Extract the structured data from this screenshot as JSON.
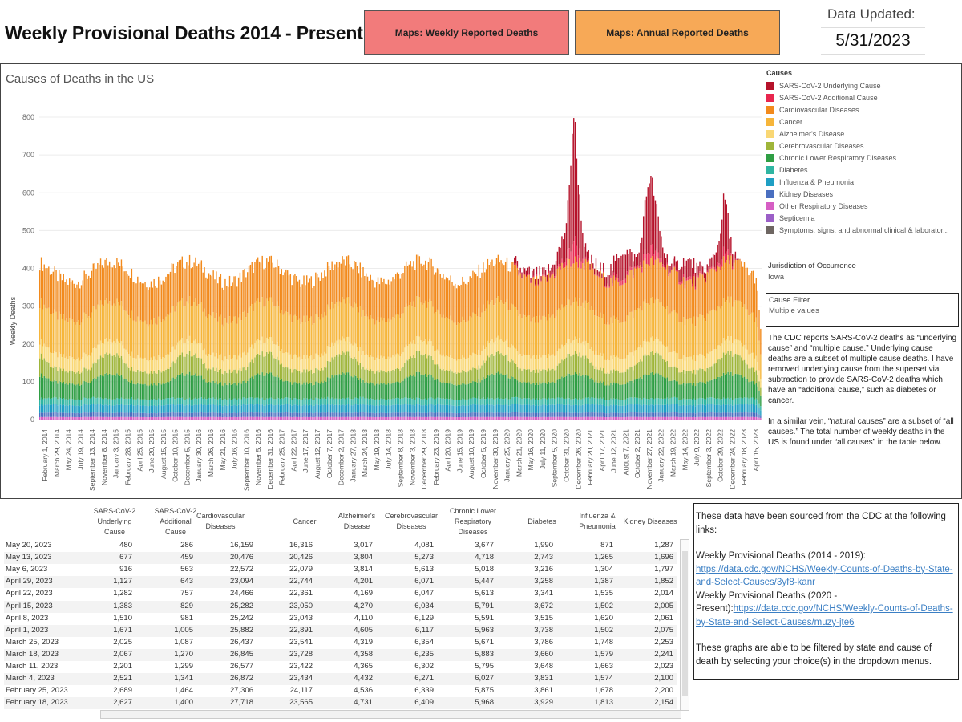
{
  "header": {
    "title": "Weekly Provisional Deaths 2014 - Present",
    "weekly_btn": "Maps: Weekly Reported Deaths",
    "annual_btn": "Maps: Annual Reported Deaths",
    "updated_label": "Data Updated:",
    "updated_value": "5/31/2023"
  },
  "chart_data": {
    "type": "bar",
    "stacked": true,
    "title": "Causes of Deaths in the US",
    "xlabel": "",
    "ylabel": "Weekly Deaths",
    "ylim": [
      0,
      800
    ],
    "yticks": [
      0,
      100,
      200,
      300,
      400,
      500,
      600,
      700,
      800
    ],
    "grid": "horizontal",
    "x_ticks": [
      "February 1, 2014",
      "March 29, 2014",
      "May 24, 2014",
      "July 19, 2014",
      "September 13, 2014",
      "November 8, 2014",
      "January 3, 2015",
      "February 28, 2015",
      "April 25, 2015",
      "June 20, 2015",
      "August 15, 2015",
      "October 10, 2015",
      "December 5, 2015",
      "January 30, 2016",
      "March 26, 2016",
      "May 21, 2016",
      "July 16, 2016",
      "September 10, 2016",
      "November 5, 2016",
      "December 31, 2016",
      "February 25, 2017",
      "April 22, 2017",
      "June 17, 2017",
      "August 12, 2017",
      "October 7, 2017",
      "December 2, 2017",
      "January 27, 2018",
      "March 24, 2018",
      "May 19, 2018",
      "July 14, 2018",
      "September 8, 2018",
      "November 3, 2018",
      "December 29, 2018",
      "February 23, 2019",
      "April 20, 2019",
      "June 15, 2019",
      "August 10, 2019",
      "October 5, 2019",
      "November 30, 2019",
      "January 25, 2020",
      "March 21, 2020",
      "May 16, 2020",
      "July 11, 2020",
      "September 5, 2020",
      "October 31, 2020",
      "December 26, 2020",
      "February 20, 2021",
      "April 17, 2021",
      "June 12, 2021",
      "August 7, 2021",
      "October 2, 2021",
      "November 27, 2021",
      "January 22, 2022",
      "March 19, 2022",
      "May 14, 2022",
      "July 9, 2022",
      "September 3, 2022",
      "October 29, 2022",
      "December 24, 2022",
      "February 18, 2023",
      "April 15, 2023"
    ],
    "series_order": [
      "Other Respiratory Diseases",
      "Kidney Diseases",
      "Influenza & Pneumonia",
      "Diabetes",
      "Chronic Lower Respiratory Diseases",
      "Cerebrovascular Diseases",
      "Alzheimer's Disease",
      "Cancer",
      "Cardiovascular Diseases",
      "SARS-CoV-2 Additional Cause",
      "SARS-CoV-2 Underlying Cause"
    ],
    "approx_weekly_totals": {
      "baseline_range": [
        340,
        470
      ],
      "peaks": [
        {
          "week": "January 3, 2015",
          "total": 515
        },
        {
          "week": "January 1, 2017",
          "total": 492
        },
        {
          "week": "March 2020 onward spike",
          "total": 490
        },
        {
          "week": "December 2020 peak",
          "total": 820
        },
        {
          "week": "January 2022 peak",
          "total": 640
        },
        {
          "week": "December 2022 peak",
          "total": 560
        }
      ],
      "last_week_total": 240
    }
  },
  "legend": {
    "title": "Causes",
    "items": [
      {
        "label": "SARS-CoV-2 Underlying Cause",
        "color": "#b5122a"
      },
      {
        "label": "SARS-CoV-2 Additional Cause",
        "color": "#e8264e"
      },
      {
        "label": "Cardiovascular Diseases",
        "color": "#f28a1c"
      },
      {
        "label": "Cancer",
        "color": "#f6b53a"
      },
      {
        "label": "Alzheimer's Disease",
        "color": "#f9d774"
      },
      {
        "label": "Cerebrovascular Diseases",
        "color": "#9fb53a"
      },
      {
        "label": "Chronic Lower Respiratory Diseases",
        "color": "#2f9e44"
      },
      {
        "label": "Diabetes",
        "color": "#2fb5a2"
      },
      {
        "label": "Influenza & Pneumonia",
        "color": "#1f9fc4"
      },
      {
        "label": "Kidney Diseases",
        "color": "#4a6fc0"
      },
      {
        "label": "Other Respiratory Diseases",
        "color": "#d65ec4"
      },
      {
        "label": "Septicemia",
        "color": "#9b5fc7"
      },
      {
        "label": "Symptoms, signs, and abnormal clinical & laborator...",
        "color": "#6e6662"
      }
    ]
  },
  "jurisdiction": {
    "label": "Jurisdiction of Occurrence",
    "value": "Iowa"
  },
  "cause_filter": {
    "label": "Cause Filter",
    "value": "Multiple values"
  },
  "note": {
    "p1": "The CDC reports SARS-CoV-2 deaths as “underlying cause” and “multiple cause.” Underlying cause deaths are a subset of multiple cause deaths. I have removed underlying cause from the superset via subtraction to provide SARS-CoV-2 deaths which have an “additional cause,” such as diabetes or cancer.",
    "p2": "In a similar vein, “natural causes” are a subset of “all causes.” The total number of weekly deaths in the US is found under “all causes” in the table below."
  },
  "table": {
    "headers": [
      "SARS-CoV-2 Underlying Cause",
      "SARS-CoV-2 Additional Cause",
      "Cardiovascular Diseases",
      "Cancer",
      "Alzheimer's Disease",
      "Cerebrovascular Diseases",
      "Chronic Lower Respiratory Diseases",
      "Diabetes",
      "Influenza & Pneumonia",
      "Kidney Diseases"
    ],
    "rows": [
      [
        "May 20, 2023",
        "480",
        "286",
        "16,159",
        "16,316",
        "3,017",
        "4,081",
        "3,677",
        "1,990",
        "871",
        "1,287"
      ],
      [
        "May 13, 2023",
        "677",
        "459",
        "20,476",
        "20,426",
        "3,804",
        "5,273",
        "4,718",
        "2,743",
        "1,265",
        "1,696"
      ],
      [
        "May 6, 2023",
        "916",
        "563",
        "22,572",
        "22,079",
        "3,814",
        "5,613",
        "5,018",
        "3,216",
        "1,304",
        "1,797"
      ],
      [
        "April 29, 2023",
        "1,127",
        "643",
        "23,094",
        "22,744",
        "4,201",
        "6,071",
        "5,447",
        "3,258",
        "1,387",
        "1,852"
      ],
      [
        "April 22, 2023",
        "1,282",
        "757",
        "24,466",
        "22,361",
        "4,169",
        "6,047",
        "5,613",
        "3,341",
        "1,535",
        "2,014"
      ],
      [
        "April 15, 2023",
        "1,383",
        "829",
        "25,282",
        "23,050",
        "4,270",
        "6,034",
        "5,791",
        "3,672",
        "1,502",
        "2,005"
      ],
      [
        "April 8, 2023",
        "1,510",
        "981",
        "25,242",
        "23,043",
        "4,110",
        "6,129",
        "5,591",
        "3,515",
        "1,620",
        "2,061"
      ],
      [
        "April 1, 2023",
        "1,671",
        "1,005",
        "25,882",
        "22,891",
        "4,605",
        "6,117",
        "5,963",
        "3,738",
        "1,502",
        "2,075"
      ],
      [
        "March 25, 2023",
        "2,025",
        "1,087",
        "26,437",
        "23,541",
        "4,319",
        "6,354",
        "5,671",
        "3,786",
        "1,748",
        "2,253"
      ],
      [
        "March 18, 2023",
        "2,067",
        "1,270",
        "26,845",
        "23,728",
        "4,358",
        "6,235",
        "5,883",
        "3,660",
        "1,579",
        "2,241"
      ],
      [
        "March 11, 2023",
        "2,201",
        "1,299",
        "26,577",
        "23,422",
        "4,365",
        "6,302",
        "5,795",
        "3,648",
        "1,663",
        "2,023"
      ],
      [
        "March 4, 2023",
        "2,521",
        "1,341",
        "26,872",
        "23,434",
        "4,432",
        "6,271",
        "6,027",
        "3,831",
        "1,574",
        "2,100"
      ],
      [
        "February 25, 2023",
        "2,689",
        "1,464",
        "27,306",
        "24,117",
        "4,536",
        "6,339",
        "5,875",
        "3,861",
        "1,678",
        "2,200"
      ],
      [
        "February 18, 2023",
        "2,627",
        "1,400",
        "27,718",
        "23,565",
        "4,731",
        "6,409",
        "5,968",
        "3,929",
        "1,813",
        "2,154"
      ]
    ]
  },
  "sources": {
    "intro": "These data have been sourced from the CDC at the following links:",
    "link1_label": "Weekly Provisional Deaths (2014 - 2019): ",
    "link1_text": "https://data.cdc.gov/NCHS/Weekly-Counts-of-Deaths-by-State-and-Select-Causes/3yf8-kanr",
    "link2_label": "Weekly Provisional Deaths (2020 - Present):",
    "link2_text": "https://data.cdc.gov/NCHS/Weekly-Counts-of-Deaths-by-State-and-Select-Causes/muzy-jte6",
    "outro": "These graphs are able to be filtered by state and cause of death by selecting your choice(s) in the dropdown menus."
  }
}
